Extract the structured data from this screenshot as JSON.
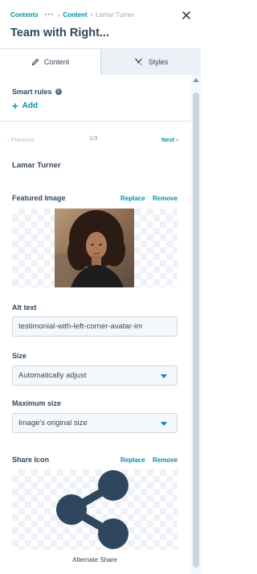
{
  "breadcrumb": {
    "root": "Contents",
    "more": "···",
    "parent": "Content",
    "current": "Lamar Turner"
  },
  "header": {
    "title": "Team with Right..."
  },
  "tabs": [
    {
      "label": "Content",
      "icon": "pencil-icon",
      "active": true
    },
    {
      "label": "Styles",
      "icon": "brush-icon",
      "active": false
    }
  ],
  "smart_rules": {
    "label": "Smart rules",
    "info_icon": "i",
    "add_label": "Add"
  },
  "pager": {
    "previous": "Previous",
    "count": "1/3",
    "next": "Next"
  },
  "item": {
    "name": "Lamar Turner"
  },
  "featured_image": {
    "label": "Featured Image",
    "replace": "Replace",
    "remove": "Remove"
  },
  "alt_text": {
    "label": "Alt text",
    "value": "testimonial-with-left-corner-avatar-im"
  },
  "size": {
    "label": "Size",
    "value": "Automatically adjust"
  },
  "max_size": {
    "label": "Maximum size",
    "value": "Image's original size"
  },
  "share_icon": {
    "label": "Share Icon",
    "replace": "Replace",
    "remove": "Remove",
    "caption": "Alternate Share"
  },
  "colors": {
    "accent": "#0091ae",
    "text": "#33475b",
    "icon": "#2f475e"
  }
}
